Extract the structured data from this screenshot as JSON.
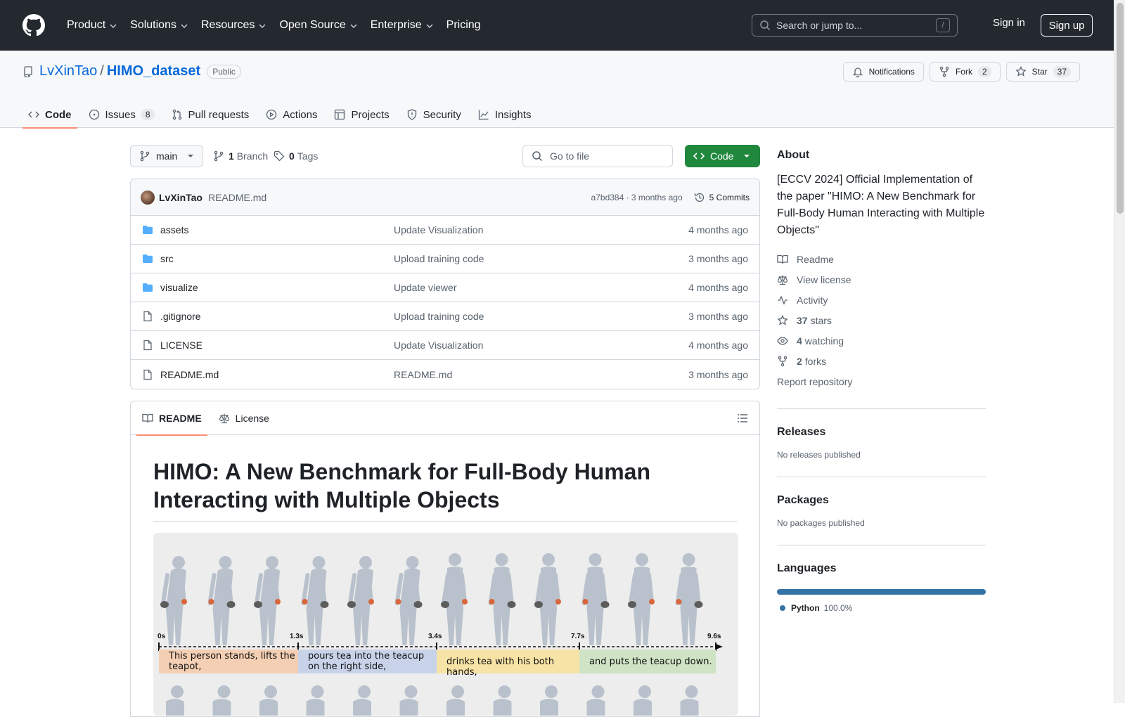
{
  "header": {
    "nav": [
      {
        "label": "Product",
        "has_menu": true
      },
      {
        "label": "Solutions",
        "has_menu": true
      },
      {
        "label": "Resources",
        "has_menu": true
      },
      {
        "label": "Open Source",
        "has_menu": true
      },
      {
        "label": "Enterprise",
        "has_menu": true
      },
      {
        "label": "Pricing",
        "has_menu": false
      }
    ],
    "search_placeholder": "Search or jump to...",
    "search_key": "/",
    "sign_in": "Sign in",
    "sign_up": "Sign up"
  },
  "repo": {
    "owner": "LvXinTao",
    "separator": "/",
    "name": "HIMO_dataset",
    "visibility": "Public",
    "notifications_label": "Notifications",
    "fork_label": "Fork",
    "fork_count": "2",
    "star_label": "Star",
    "star_count": "37"
  },
  "tabs": [
    {
      "label": "Code",
      "icon": "code-icon",
      "active": true,
      "count": ""
    },
    {
      "label": "Issues",
      "icon": "issue-icon",
      "active": false,
      "count": "8"
    },
    {
      "label": "Pull requests",
      "icon": "pull-request-icon",
      "active": false,
      "count": ""
    },
    {
      "label": "Actions",
      "icon": "play-icon",
      "active": false,
      "count": ""
    },
    {
      "label": "Projects",
      "icon": "table-icon",
      "active": false,
      "count": ""
    },
    {
      "label": "Security",
      "icon": "shield-icon",
      "active": false,
      "count": ""
    },
    {
      "label": "Insights",
      "icon": "graph-icon",
      "active": false,
      "count": ""
    }
  ],
  "toolbar": {
    "branch": "main",
    "branch_count": "1",
    "branch_label": "Branch",
    "tag_count": "0",
    "tag_label": "Tags",
    "goto_placeholder": "Go to file",
    "code_label": "Code"
  },
  "commit": {
    "author": "LvXinTao",
    "message": "README.md",
    "hash_time": "a7bd384 · 3 months ago",
    "commits_label": "5 Commits"
  },
  "files": [
    {
      "name": "assets",
      "type": "folder",
      "message": "Update Visualization",
      "time": "4 months ago"
    },
    {
      "name": "src",
      "type": "folder",
      "message": "Upload training code",
      "time": "3 months ago"
    },
    {
      "name": "visualize",
      "type": "folder",
      "message": "Update viewer",
      "time": "4 months ago"
    },
    {
      "name": ".gitignore",
      "type": "file",
      "message": "Upload training code",
      "time": "3 months ago"
    },
    {
      "name": "LICENSE",
      "type": "file",
      "message": "Update Visualization",
      "time": "4 months ago"
    },
    {
      "name": "README.md",
      "type": "file",
      "message": "README.md",
      "time": "3 months ago"
    }
  ],
  "readme": {
    "tabs": [
      "README",
      "License"
    ],
    "title": "HIMO: A New Benchmark for Full-Body Human Interacting with Multiple Objects",
    "figure": {
      "times": [
        "0s",
        "1.3s",
        "3.4s",
        "7.7s",
        "9.6s"
      ],
      "segments": [
        {
          "text": "This person stands, lifts the teapot,",
          "color": "#f4cfb3"
        },
        {
          "text": "pours tea into the teacup on the right side,",
          "color": "#c8d3ea"
        },
        {
          "text": "drinks tea with his both hands,",
          "color": "#f7e3a5"
        },
        {
          "text": "and puts the teacup down.",
          "color": "#cfe3c5"
        }
      ]
    }
  },
  "about": {
    "heading": "About",
    "description": "[ECCV 2024] Official Implementation of the paper \"HIMO: A New Benchmark for Full-Body Human Interacting with Multiple Objects\"",
    "readme": "Readme",
    "license": "View license",
    "activity": "Activity",
    "stars_count": "37",
    "stars_label": "stars",
    "watching_count": "4",
    "watching_label": "watching",
    "forks_count": "2",
    "forks_label": "forks",
    "report": "Report repository"
  },
  "releases": {
    "heading": "Releases",
    "note": "No releases published"
  },
  "packages": {
    "heading": "Packages",
    "note": "No packages published"
  },
  "languages": {
    "heading": "Languages",
    "items": [
      {
        "name": "Python",
        "percent": "100.0%",
        "color": "#3572A5"
      }
    ]
  }
}
